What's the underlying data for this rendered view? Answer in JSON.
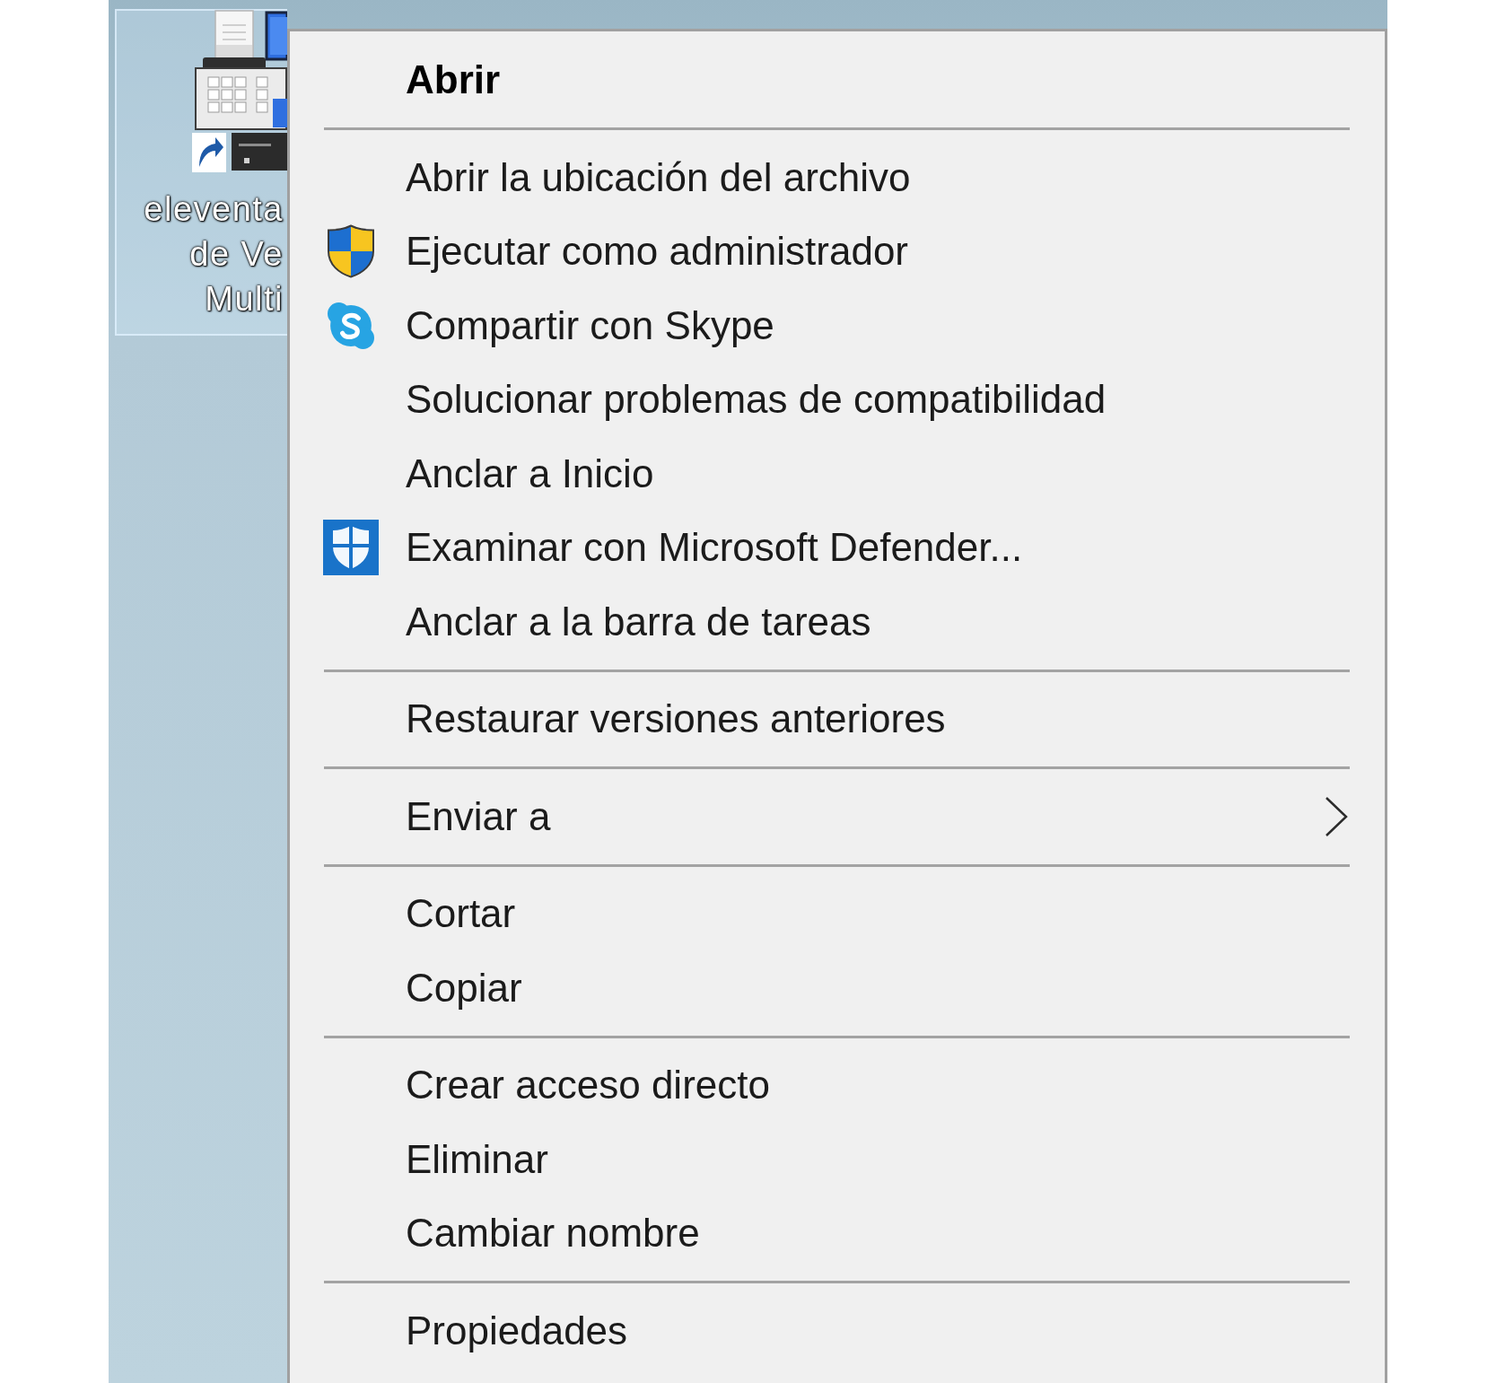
{
  "desktop": {
    "shortcut": {
      "selected": true,
      "label_lines": [
        "eleventa",
        "de Ve",
        "Multi"
      ]
    }
  },
  "context_menu": {
    "groups": [
      [
        {
          "label": "Abrir",
          "kind": "command",
          "default": true,
          "submenu": false
        }
      ],
      [
        {
          "label": "Abrir la ubicación del archivo",
          "kind": "command",
          "default": false,
          "submenu": false
        },
        {
          "label": "Ejecutar como administrador",
          "kind": "elevated",
          "default": false,
          "submenu": false
        },
        {
          "label": "Compartir con Skype",
          "kind": "share",
          "default": false,
          "submenu": false
        },
        {
          "label": "Solucionar problemas de compatibilidad",
          "kind": "command",
          "default": false,
          "submenu": false
        },
        {
          "label": "Anclar a Inicio",
          "kind": "command",
          "default": false,
          "submenu": false
        },
        {
          "label": "Examinar con Microsoft Defender...",
          "kind": "scan",
          "default": false,
          "submenu": false
        },
        {
          "label": "Anclar a la barra de tareas",
          "kind": "command",
          "default": false,
          "submenu": false
        }
      ],
      [
        {
          "label": "Restaurar versiones anteriores",
          "kind": "command",
          "default": false,
          "submenu": false
        }
      ],
      [
        {
          "label": "Enviar a",
          "kind": "command",
          "default": false,
          "submenu": true
        }
      ],
      [
        {
          "label": "Cortar",
          "kind": "command",
          "default": false,
          "submenu": false
        },
        {
          "label": "Copiar",
          "kind": "command",
          "default": false,
          "submenu": false
        }
      ],
      [
        {
          "label": "Crear acceso directo",
          "kind": "command",
          "default": false,
          "submenu": false
        },
        {
          "label": "Eliminar",
          "kind": "command",
          "default": false,
          "submenu": false
        },
        {
          "label": "Cambiar nombre",
          "kind": "command",
          "default": false,
          "submenu": false
        }
      ],
      [
        {
          "label": "Propiedades",
          "kind": "command",
          "default": false,
          "submenu": false
        }
      ]
    ]
  }
}
